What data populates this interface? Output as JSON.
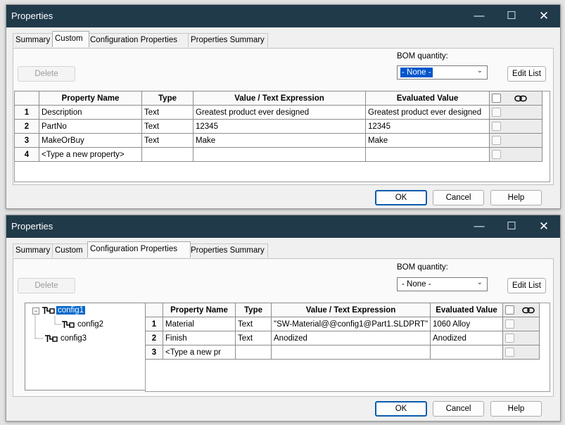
{
  "dialog1": {
    "title": "Properties",
    "tabs": [
      "Summary",
      "Custom",
      "Configuration Properties",
      "Properties Summary"
    ],
    "active_tab": "Custom",
    "delete_label": "Delete",
    "bom_label": "BOM quantity:",
    "bom_value": "- None -",
    "edit_list_label": "Edit List",
    "columns": [
      "",
      "Property Name",
      "Type",
      "Value / Text Expression",
      "Evaluated Value"
    ],
    "rows": [
      {
        "num": "1",
        "name": "Description",
        "type": "Text",
        "value": "Greatest product ever designed",
        "evaluated": "Greatest product ever designed"
      },
      {
        "num": "2",
        "name": "PartNo",
        "type": "Text",
        "value": "12345",
        "evaluated": "12345"
      },
      {
        "num": "3",
        "name": "MakeOrBuy",
        "type": "Text",
        "value": "Make",
        "evaluated": "Make"
      },
      {
        "num": "4",
        "name": "<Type a new property>",
        "type": "",
        "value": "",
        "evaluated": ""
      }
    ],
    "ok_label": "OK",
    "cancel_label": "Cancel",
    "help_label": "Help"
  },
  "dialog2": {
    "title": "Properties",
    "tabs": [
      "Summary",
      "Custom",
      "Configuration Properties",
      "Properties Summary"
    ],
    "active_tab": "Configuration Properties",
    "delete_label": "Delete",
    "bom_label": "BOM quantity:",
    "bom_value": "- None -",
    "edit_list_label": "Edit List",
    "tree": [
      {
        "label": "config1",
        "selected": true
      },
      {
        "label": "config2",
        "selected": false
      },
      {
        "label": "config3",
        "selected": false
      }
    ],
    "columns": [
      "",
      "Property Name",
      "Type",
      "Value / Text Expression",
      "Evaluated Value"
    ],
    "rows": [
      {
        "num": "1",
        "name": "Material",
        "type": "Text",
        "value": "\"SW-Material@@config1@Part1.SLDPRT\"",
        "evaluated": "1060 Alloy"
      },
      {
        "num": "2",
        "name": "Finish",
        "type": "Text",
        "value": "Anodized",
        "evaluated": "Anodized"
      },
      {
        "num": "3",
        "name": "<Type a new pr",
        "type": "",
        "value": "",
        "evaluated": ""
      }
    ],
    "ok_label": "OK",
    "cancel_label": "Cancel",
    "help_label": "Help"
  },
  "colors": {
    "titlebar": "#203a4a",
    "selection": "#0066cc",
    "default_button_border": "#0b5cad"
  }
}
